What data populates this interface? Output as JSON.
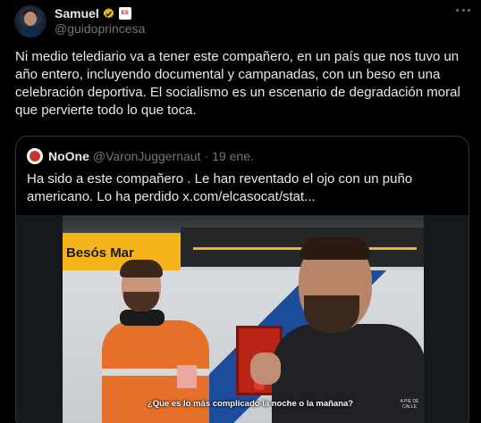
{
  "author": {
    "display_name": "Samuel",
    "handle": "@guidoprincesa",
    "affiliate_badge": "ES",
    "more_icon": "more-dots-icon"
  },
  "tweet_text": "Ni medio telediario va a tener este compañero, en un país que nos tuvo un año entero, incluyendo documental y campanadas, con un beso en una celebración deportiva. El socialismo es un escenario de degradación moral que pervierte todo lo que toca.",
  "quote": {
    "display_name": "NoOne",
    "handle": "@VaronJuggernaut",
    "separator": "·",
    "time": "19 ene.",
    "text": "Ha sido a este compañero . Le han reventado el ojo con un puño americano. Lo ha perdido  x.com/elcasocat/stat..."
  },
  "media": {
    "station_sign": "Besós Mar",
    "subtitle": "¿Que es lo más complicado la noche o la mañana?",
    "watermark": "A PIE DE CALLE"
  },
  "colors": {
    "background": "#000000",
    "text_primary": "#e7e9ea",
    "text_secondary": "#71767b",
    "verified_gold": "#e2b719",
    "border": "#2f3336"
  }
}
